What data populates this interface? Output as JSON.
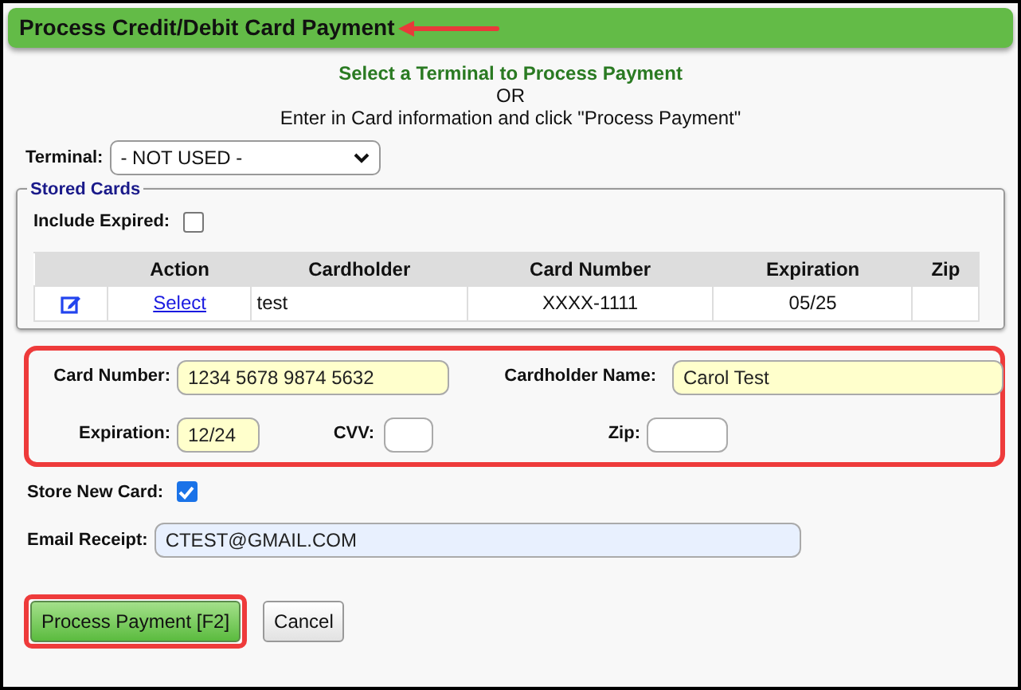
{
  "header": {
    "title": "Process Credit/Debit Card Payment"
  },
  "instructions": [
    {
      "kind": "heading",
      "text": "Select a Terminal to Process Payment"
    },
    {
      "kind": "plain",
      "text": "OR"
    },
    {
      "kind": "plain",
      "text": "Enter in Card information and click \"Process Payment\""
    }
  ],
  "terminal": {
    "label": "Terminal:",
    "value": "- NOT USED -"
  },
  "stored_cards": {
    "legend": "Stored Cards",
    "include_expired": {
      "label": "Include Expired:",
      "checked": false
    },
    "columns": [
      "",
      "Action",
      "Cardholder",
      "Card Number",
      "Expiration",
      "Zip"
    ],
    "rows": [
      {
        "action": "Select",
        "cardholder": "test",
        "card_number": "XXXX-1111",
        "expiration": "05/25"
      }
    ]
  },
  "card_fields": [
    {
      "label": "Card Number:",
      "value": "1234 5678 9874 5632",
      "highlighted": true
    },
    {
      "label": "Cardholder Name:",
      "value": "Carol Test",
      "highlighted": true
    },
    {
      "label": "Expiration:",
      "value": "12/24",
      "highlighted": true
    },
    {
      "label": "CVV:",
      "highlighted": false
    },
    {
      "label": "Zip:",
      "highlighted": false
    }
  ],
  "store_new_card": {
    "label": "Store New Card:",
    "checked": true
  },
  "email_receipt": {
    "label": "Email Receipt:",
    "value": "CTEST@GMAIL.COM"
  },
  "buttons": [
    {
      "label": "Process Payment [F2]",
      "kind": "primary"
    },
    {
      "label": "Cancel",
      "kind": "secondary"
    }
  ]
}
